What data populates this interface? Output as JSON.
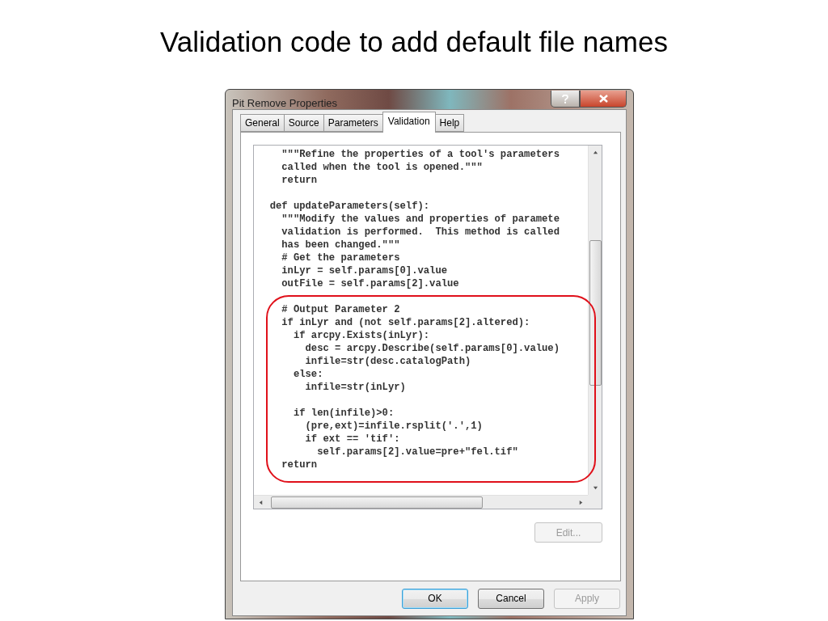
{
  "slide_title": "Validation code to add default file names",
  "window": {
    "title": "Pit Remove Properties"
  },
  "tabs": [
    {
      "label": "General",
      "selected": false
    },
    {
      "label": "Source",
      "selected": false
    },
    {
      "label": "Parameters",
      "selected": false
    },
    {
      "label": "Validation",
      "selected": true
    },
    {
      "label": "Help",
      "selected": false
    }
  ],
  "code_blocks": [
    [
      "    \"\"\"Refine the properties of a tool's parameters",
      "    called when the tool is opened.\"\"\"",
      "    return"
    ],
    [
      "  def updateParameters(self):",
      "    \"\"\"Modify the values and properties of paramete",
      "    validation is performed.  This method is called",
      "    has been changed.\"\"\"",
      "    # Get the parameters",
      "    inLyr = self.params[0].value",
      "    outFile = self.params[2].value"
    ],
    [
      "    # Output Parameter 2",
      "    if inLyr and (not self.params[2].altered):",
      "      if arcpy.Exists(inLyr):",
      "        desc = arcpy.Describe(self.params[0].value)",
      "        infile=str(desc.catalogPath)",
      "      else:",
      "        infile=str(inLyr)"
    ],
    [
      "      if len(infile)>0:",
      "        (pre,ext)=infile.rsplit('.',1)",
      "        if ext == 'tif':",
      "          self.params[2].value=pre+\"fel.tif\"",
      "    return"
    ]
  ],
  "edit_button": {
    "label": "Edit...",
    "disabled": true
  },
  "buttons": [
    {
      "label": "OK",
      "default": true,
      "disabled": false
    },
    {
      "label": "Cancel",
      "default": false,
      "disabled": false
    },
    {
      "label": "Apply",
      "default": false,
      "disabled": true
    }
  ]
}
